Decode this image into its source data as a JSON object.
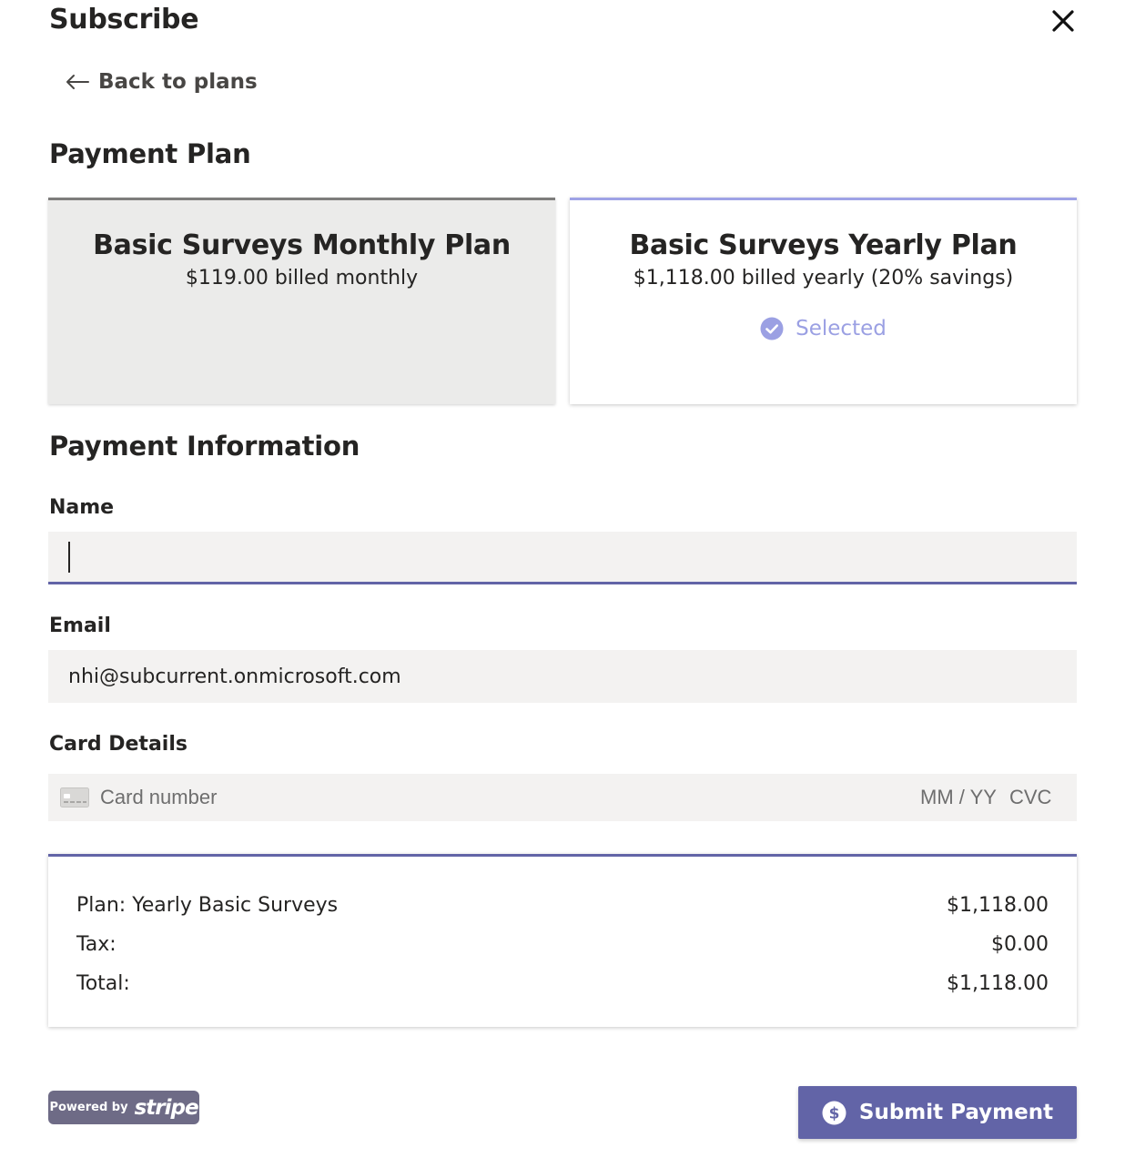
{
  "dialog": {
    "title": "Subscribe",
    "close_icon": "close-icon",
    "back_link": {
      "label": "Back to plans",
      "icon": "arrow-left-icon"
    }
  },
  "payment_plan": {
    "heading": "Payment Plan",
    "plans": [
      {
        "name": "Basic Surveys Monthly Plan",
        "price": "$119.00 billed monthly",
        "selected": false
      },
      {
        "name": "Basic Surveys Yearly Plan",
        "price": "$1,118.00 billed yearly (20% savings)",
        "selected": true,
        "selected_label": "Selected",
        "selected_icon": "check-circle-icon"
      }
    ]
  },
  "payment_information": {
    "heading": "Payment Information",
    "name": {
      "label": "Name",
      "value": ""
    },
    "email": {
      "label": "Email",
      "value": "nhi@subcurrent.onmicrosoft.com"
    },
    "card": {
      "label": "Card Details",
      "icon": "credit-card-icon",
      "number_placeholder": "Card number",
      "expiry_placeholder": "MM / YY",
      "cvc_placeholder": "CVC"
    }
  },
  "summary": {
    "rows": [
      {
        "label": "Plan: Yearly Basic Surveys",
        "value": "$1,118.00"
      },
      {
        "label": "Tax:",
        "value": "$0.00"
      },
      {
        "label": "Total:",
        "value": "$1,118.00"
      }
    ]
  },
  "footer": {
    "powered_by": "Powered by",
    "stripe": "stripe",
    "submit": {
      "label": "Submit Payment",
      "icon": "dollar-circle-icon"
    }
  },
  "colors": {
    "accent": "#6264a7",
    "selected_accent": "#9ba0e3",
    "field_background": "#f3f2f1",
    "unselected_card_background": "#ebebea"
  }
}
